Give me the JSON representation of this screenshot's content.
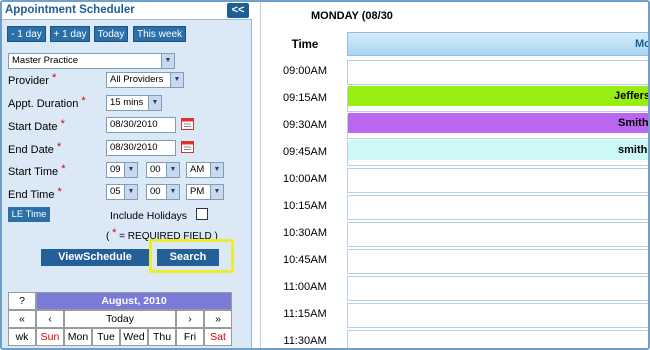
{
  "scheduler": {
    "title": "Appointment Scheduler",
    "collapse_label": "<<",
    "quick_buttons": [
      "- 1 day",
      "+ 1 day",
      "Today",
      "This week"
    ],
    "practice": "Master Practice",
    "provider_label": "Provider",
    "provider_value": "All Providers",
    "duration_label": "Appt. Duration",
    "duration_value": "15 mins",
    "start_date_label": "Start Date",
    "start_date_value": "08/30/2010",
    "end_date_label": "End Date",
    "end_date_value": "08/30/2010",
    "start_time_label": "Start Time",
    "start_time": {
      "hour": "09",
      "minute": "00",
      "ampm": "AM"
    },
    "end_time_label": "End Time",
    "end_time": {
      "hour": "05",
      "minute": "00",
      "ampm": "PM"
    },
    "le_time_label": "LE Time",
    "include_holidays_label": "Include Holidays",
    "required_note_open": "(",
    "required_star": "*",
    "required_note_text": " = REQUIRED FIELD )",
    "view_schedule_label": "ViewSchedule",
    "search_label": "Search"
  },
  "calendar": {
    "help": "?",
    "month_title": "August, 2010",
    "prev_year": "«",
    "prev_month": "‹",
    "today": "Today",
    "next_month": "›",
    "next_year": "»",
    "weekday_headers": [
      "wk",
      "Sun",
      "Mon",
      "Tue",
      "Wed",
      "Thu",
      "Fri",
      "Sat"
    ]
  },
  "schedule": {
    "day_title": "MONDAY (08/30",
    "time_header": "Time",
    "column_header": "Mo",
    "times": [
      "09:00AM",
      "09:15AM",
      "09:30AM",
      "09:45AM",
      "10:00AM",
      "10:15AM",
      "10:30AM",
      "10:45AM",
      "11:00AM",
      "11:15AM",
      "11:30AM"
    ],
    "appointments": [
      {
        "name": "Jeffers",
        "color": "#99ee11"
      },
      {
        "name": "Smith",
        "color": "#bb66ee"
      },
      {
        "name": "smith",
        "color": "#ccf8f8"
      }
    ]
  },
  "colors": {
    "accent": "#2b6fa8",
    "panel": "#dbe8f5",
    "highlight": "#ecec32",
    "weekend": "#d00000"
  }
}
